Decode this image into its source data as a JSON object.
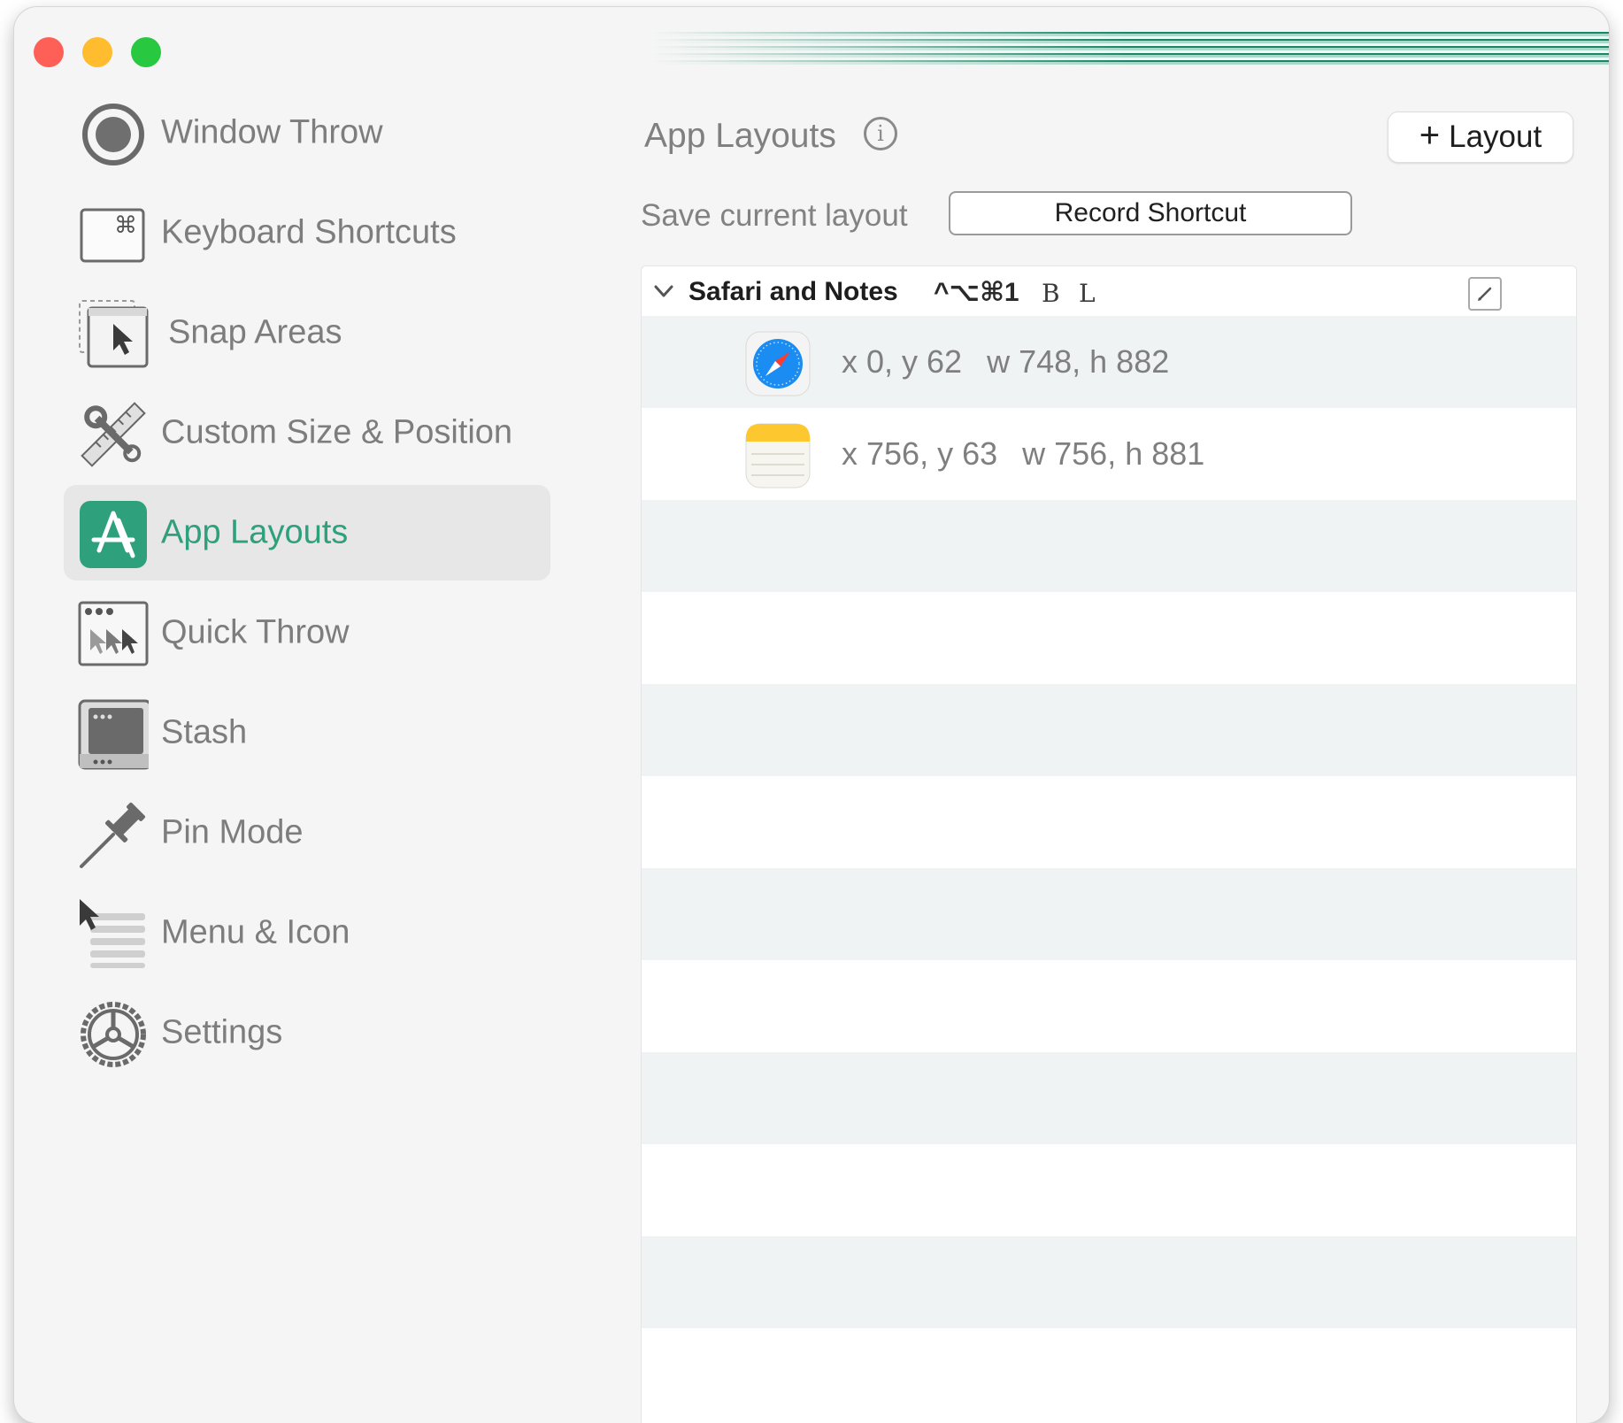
{
  "sidebar": {
    "items": [
      {
        "label": "Window Throw",
        "icon": "window-throw-icon"
      },
      {
        "label": "Keyboard Shortcuts",
        "icon": "keyboard-shortcuts-icon"
      },
      {
        "label": "Snap Areas",
        "icon": "snap-areas-icon"
      },
      {
        "label": "Custom Size & Position",
        "icon": "custom-size-icon"
      },
      {
        "label": "App Layouts",
        "icon": "app-layouts-icon",
        "active": true
      },
      {
        "label": "Quick Throw",
        "icon": "quick-throw-icon"
      },
      {
        "label": "Stash",
        "icon": "stash-icon"
      },
      {
        "label": "Pin Mode",
        "icon": "pin-icon"
      },
      {
        "label": "Menu & Icon",
        "icon": "menu-icon"
      },
      {
        "label": "Settings",
        "icon": "gear-icon"
      }
    ]
  },
  "main": {
    "title": "App Layouts",
    "info_glyph": "i",
    "add_layout_plus": "+",
    "add_layout_label": "Layout",
    "save_label": "Save current layout",
    "record_label": "Record Shortcut"
  },
  "layout": {
    "name": "Safari and Notes",
    "shortcut": "^⌥⌘1",
    "flag_b": "B",
    "flag_l": "L",
    "apps": [
      {
        "app": "Safari",
        "icon": "safari-icon",
        "position": "x 0, y 62",
        "size": "w 748, h 882"
      },
      {
        "app": "Notes",
        "icon": "notes-icon",
        "position": "x 756, y 63",
        "size": "w 756, h 881"
      }
    ]
  },
  "colors": {
    "accent": "#2ea07c",
    "close": "#fe5f57",
    "minimize": "#febc2e",
    "maximize": "#28c840"
  }
}
